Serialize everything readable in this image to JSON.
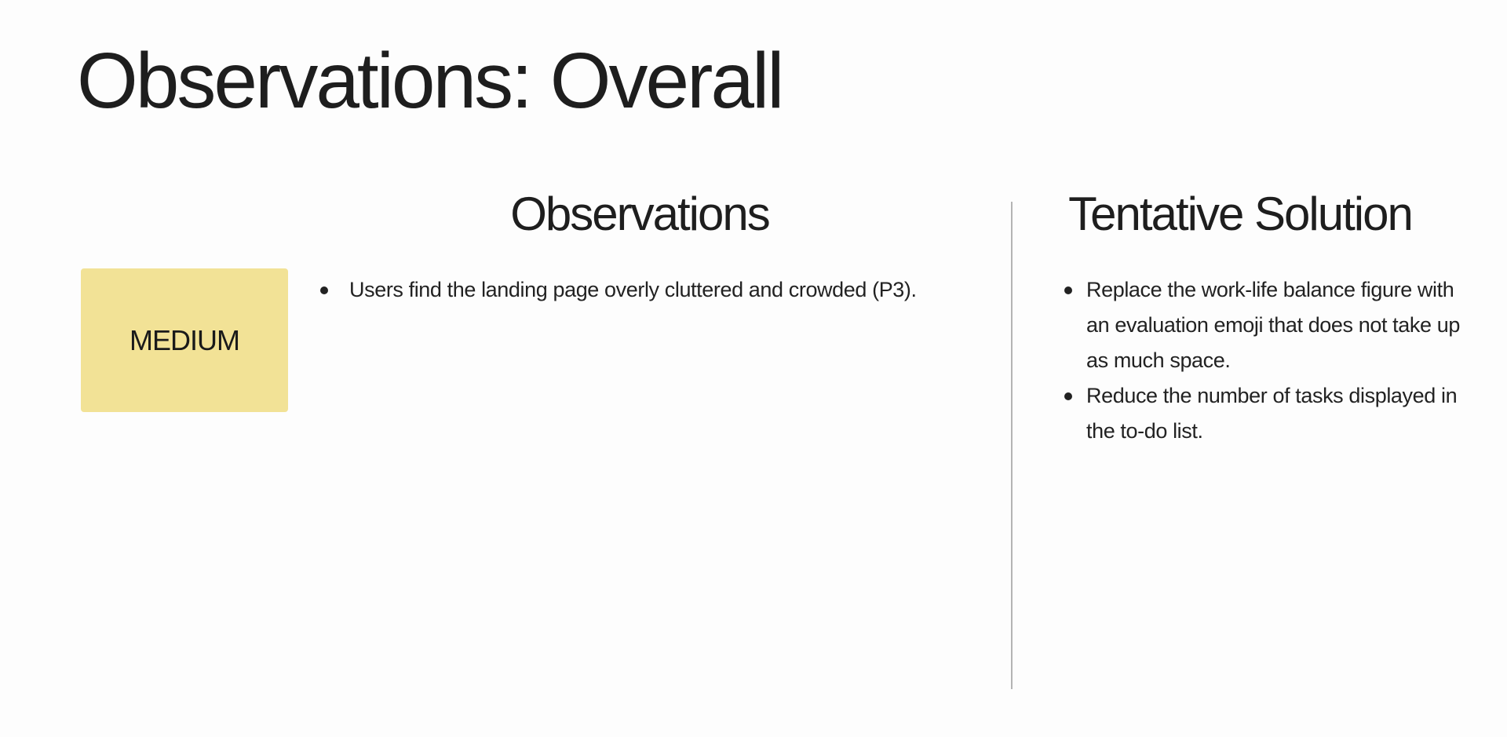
{
  "slide": {
    "title": "Observations: Overall"
  },
  "severity": {
    "label": "MEDIUM",
    "color": "#f2e296"
  },
  "observations": {
    "heading": "Observations",
    "items": [
      "Users find the landing page overly cluttered and crowded (P3)."
    ]
  },
  "solution": {
    "heading": "Tentative Solution",
    "items": [
      "Replace the work-life balance figure with an evaluation emoji that does not take up as much space.",
      "Reduce the number of tasks displayed in the to-do list."
    ]
  }
}
